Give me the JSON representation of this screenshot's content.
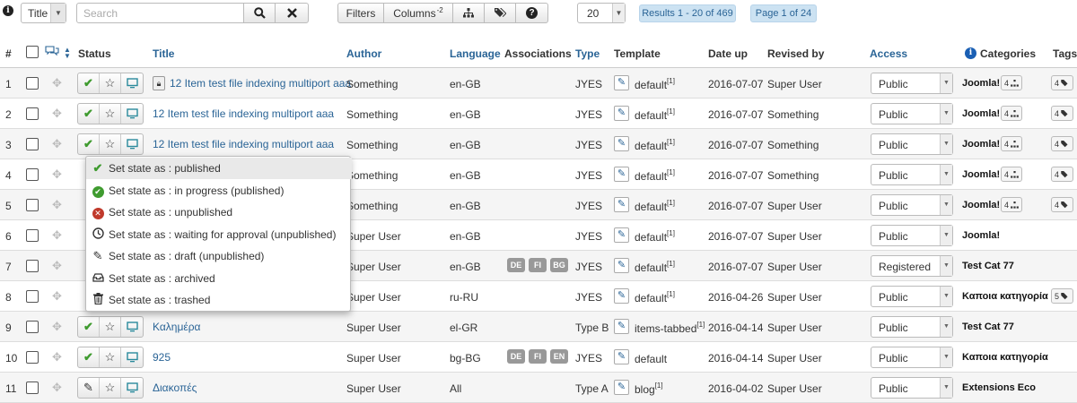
{
  "toolbar": {
    "info_icon": "i",
    "search_field_select": "Title",
    "search_placeholder": "Search",
    "filters_label": "Filters",
    "columns_label": "Columns",
    "columns_count": "-2",
    "list_limit": "20",
    "results": "Results 1 - 20 of 469",
    "page": "Page 1 of 24"
  },
  "headers": {
    "num": "#",
    "status": "Status",
    "title": "Title",
    "author": "Author",
    "language": "Language",
    "associations": "Associations",
    "type": "Type",
    "template": "Template",
    "date_up": "Date up",
    "revised_by": "Revised by",
    "access": "Access",
    "categories": "Categories",
    "tags": "Tags"
  },
  "rows": [
    {
      "num": "1",
      "state": "published",
      "locked": true,
      "title": "12 Item test file indexing multiport aaa",
      "author": "Something",
      "language": "en-GB",
      "assoc": [],
      "type": "JYES",
      "template": "default",
      "tpl_sup": "[1]",
      "date": "2016-07-07",
      "revised": "Super User",
      "access": "Public",
      "category": "Joomla!",
      "cat_count": "4",
      "tag_count": "4"
    },
    {
      "num": "2",
      "state": "published",
      "locked": false,
      "title": "12 Item test file indexing multiport aaa",
      "author": "Something",
      "language": "en-GB",
      "assoc": [],
      "type": "JYES",
      "template": "default",
      "tpl_sup": "[1]",
      "date": "2016-07-07",
      "revised": "Something",
      "access": "Public",
      "category": "Joomla!",
      "cat_count": "4",
      "tag_count": "4"
    },
    {
      "num": "3",
      "state": "published",
      "locked": false,
      "title": "12 Item test file indexing multiport aaa",
      "author": "Something",
      "language": "en-GB",
      "assoc": [],
      "type": "JYES",
      "template": "default",
      "tpl_sup": "[1]",
      "date": "2016-07-07",
      "revised": "Something",
      "access": "Public",
      "category": "Joomla!",
      "cat_count": "4",
      "tag_count": "4"
    },
    {
      "num": "4",
      "state": "",
      "locked": false,
      "title": "",
      "author": "Something",
      "language": "en-GB",
      "assoc": [],
      "type": "JYES",
      "template": "default",
      "tpl_sup": "[1]",
      "date": "2016-07-07",
      "revised": "Something",
      "access": "Public",
      "category": "Joomla!",
      "cat_count": "4",
      "tag_count": "4"
    },
    {
      "num": "5",
      "state": "",
      "locked": false,
      "title": "",
      "author": "Something",
      "language": "en-GB",
      "assoc": [],
      "type": "JYES",
      "template": "default",
      "tpl_sup": "[1]",
      "date": "2016-07-07",
      "revised": "Super User",
      "access": "Public",
      "category": "Joomla!",
      "cat_count": "4",
      "tag_count": "4"
    },
    {
      "num": "6",
      "state": "",
      "locked": false,
      "title": "",
      "author": "Super User",
      "language": "en-GB",
      "assoc": [],
      "type": "JYES",
      "template": "default",
      "tpl_sup": "[1]",
      "date": "2016-07-07",
      "revised": "Super User",
      "access": "Public",
      "category": "Joomla!",
      "cat_count": "",
      "tag_count": ""
    },
    {
      "num": "7",
      "state": "",
      "locked": false,
      "title": "",
      "author": "Super User",
      "language": "en-GB",
      "assoc": [
        "DE",
        "FI",
        "BG"
      ],
      "type": "JYES",
      "template": "default",
      "tpl_sup": "[1]",
      "date": "2016-07-07",
      "revised": "Super User",
      "access": "Registered",
      "category": "Test Cat 77",
      "cat_count": "",
      "tag_count": ""
    },
    {
      "num": "8",
      "state": "",
      "locked": false,
      "title": "",
      "author": "Super User",
      "language": "ru-RU",
      "assoc": [],
      "type": "JYES",
      "template": "default",
      "tpl_sup": "[1]",
      "date": "2016-04-26",
      "revised": "Super User",
      "access": "Public",
      "category": "Καποια κατηγορία",
      "cat_count": "",
      "tag_count": "5"
    },
    {
      "num": "9",
      "state": "published",
      "locked": false,
      "title": "Καλημέρα",
      "author": "Super User",
      "language": "el-GR",
      "assoc": [],
      "type": "Type B",
      "template": "items-tabbed",
      "tpl_sup": "[1]",
      "date": "2016-04-14",
      "revised": "Super User",
      "access": "Public",
      "category": "Test Cat 77",
      "cat_count": "",
      "tag_count": ""
    },
    {
      "num": "10",
      "state": "published",
      "locked": false,
      "title": "925",
      "author": "Super User",
      "language": "bg-BG",
      "assoc": [
        "DE",
        "FI",
        "EN"
      ],
      "type": "JYES",
      "template": "default",
      "tpl_sup": "",
      "date": "2016-04-14",
      "revised": "Super User",
      "access": "Public",
      "category": "Καποια κατηγορία",
      "cat_count": "",
      "tag_count": ""
    },
    {
      "num": "11",
      "state": "draft",
      "locked": false,
      "title": "Διακοπές",
      "author": "Super User",
      "language": "All",
      "assoc": [],
      "type": "Type A",
      "template": "blog",
      "tpl_sup": "[1]",
      "date": "2016-04-02",
      "revised": "Super User",
      "access": "Public",
      "category": "Extensions Eco",
      "cat_count": "",
      "tag_count": ""
    }
  ],
  "menu": {
    "items": [
      {
        "label": "Set state as : published",
        "icon": "check-icon"
      },
      {
        "label": "Set state as : in progress (published)",
        "icon": "check-circle-icon"
      },
      {
        "label": "Set state as : unpublished",
        "icon": "x-circle-icon"
      },
      {
        "label": "Set state as : waiting for approval (unpublished)",
        "icon": "clock-icon"
      },
      {
        "label": "Set state as : draft (unpublished)",
        "icon": "pencil-icon"
      },
      {
        "label": "Set state as : archived",
        "icon": "archive-icon"
      },
      {
        "label": "Set state as : trashed",
        "icon": "trash-icon"
      }
    ]
  },
  "colors": {
    "link": "#2a6496",
    "published": "#3f9b2f",
    "unpublished": "#c0392b",
    "badge_bg": "#cce2f2"
  }
}
